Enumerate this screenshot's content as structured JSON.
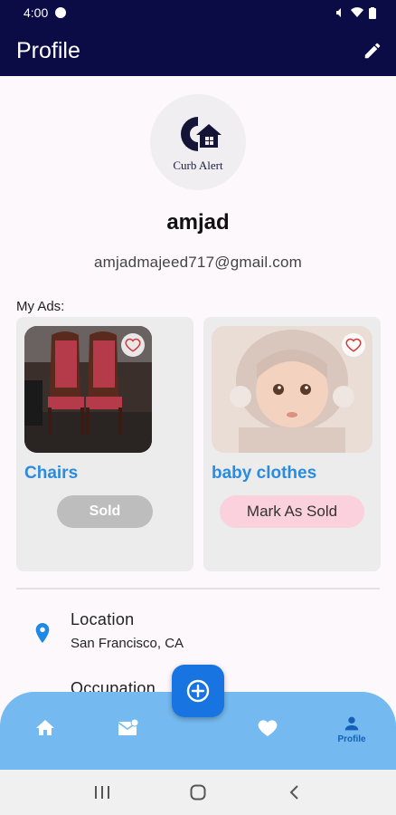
{
  "status_bar": {
    "time": "4:00"
  },
  "app_bar": {
    "title": "Profile",
    "edit_icon": "pencil-icon"
  },
  "profile": {
    "logo_text": "Curb Alert",
    "username": "amjad",
    "email": "amjadmajeed717@gmail.com"
  },
  "ads": {
    "label": "My Ads:",
    "items": [
      {
        "title": "Chairs",
        "action_label": "Sold",
        "favorite_icon": "heart-outline-icon"
      },
      {
        "title": "baby clothes",
        "action_label": "Mark As Sold",
        "favorite_icon": "heart-outline-icon"
      }
    ]
  },
  "info": [
    {
      "label": "Location",
      "value": "San Francisco, CA",
      "icon": "location-pin-icon"
    },
    {
      "label": "Occupation",
      "value": "",
      "icon": "briefcase-icon"
    }
  ],
  "bottom_nav": {
    "items": [
      {
        "icon": "home-icon",
        "label": ""
      },
      {
        "icon": "messages-icon",
        "label": ""
      },
      {
        "icon": "heart-icon",
        "label": ""
      },
      {
        "icon": "person-icon",
        "label": "Profile"
      }
    ],
    "fab_icon": "add-circle-icon"
  },
  "colors": {
    "app_bar": "#0b0b45",
    "accent_blue": "#2a8be0",
    "nav_bar": "#74b9ef",
    "fab": "#1874e0",
    "mark_sold_bg": "#fad1dc",
    "sold_bg": "#bdbdbd"
  }
}
